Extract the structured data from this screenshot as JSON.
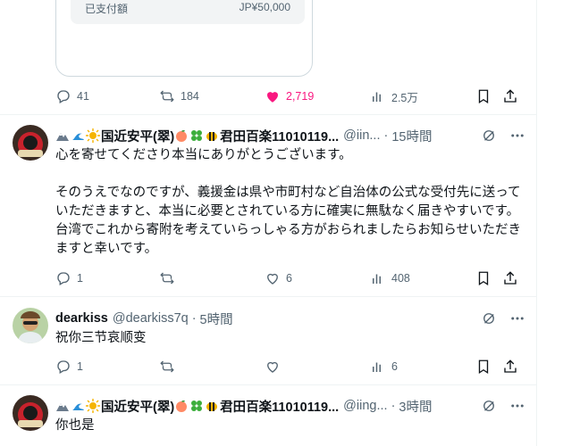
{
  "card": {
    "label": "已支付額",
    "value": "JP¥50,000"
  },
  "tweet0": {
    "replies": "41",
    "retweets": "184",
    "likes": "2,719",
    "views": "2.5万"
  },
  "reply1": {
    "name": "国近安平(翠)",
    "name_suffix": "君田百楽11010119...",
    "handle": "@iin...",
    "time": "15時間",
    "text": "心を寄せてくださり本当にありがとうございます。\n\nそのうえでなのですが、義援金は県や市町村など自治体の公式な受付先に送っていただきますと、本当に必要とされている方に確実に無駄なく届きやすいです。台湾でこれから寄附を考えていらっしゃる方がおられましたらお知らせいただきますと幸いです。",
    "replies": "1",
    "likes": "6",
    "views": "408"
  },
  "reply2": {
    "name": "dearkiss",
    "handle": "@dearkiss7q",
    "time": "5時間",
    "text": "祝你三节哀顺变",
    "replies": "1",
    "views": "6"
  },
  "reply3": {
    "name": "国近安平(翠)",
    "name_suffix": "君田百楽11010119...",
    "handle": "@iing...",
    "time": "3時間",
    "text": "你也是"
  },
  "colors": {
    "like_active": "#f91880",
    "muted": "#536471",
    "text": "#0f1419"
  }
}
